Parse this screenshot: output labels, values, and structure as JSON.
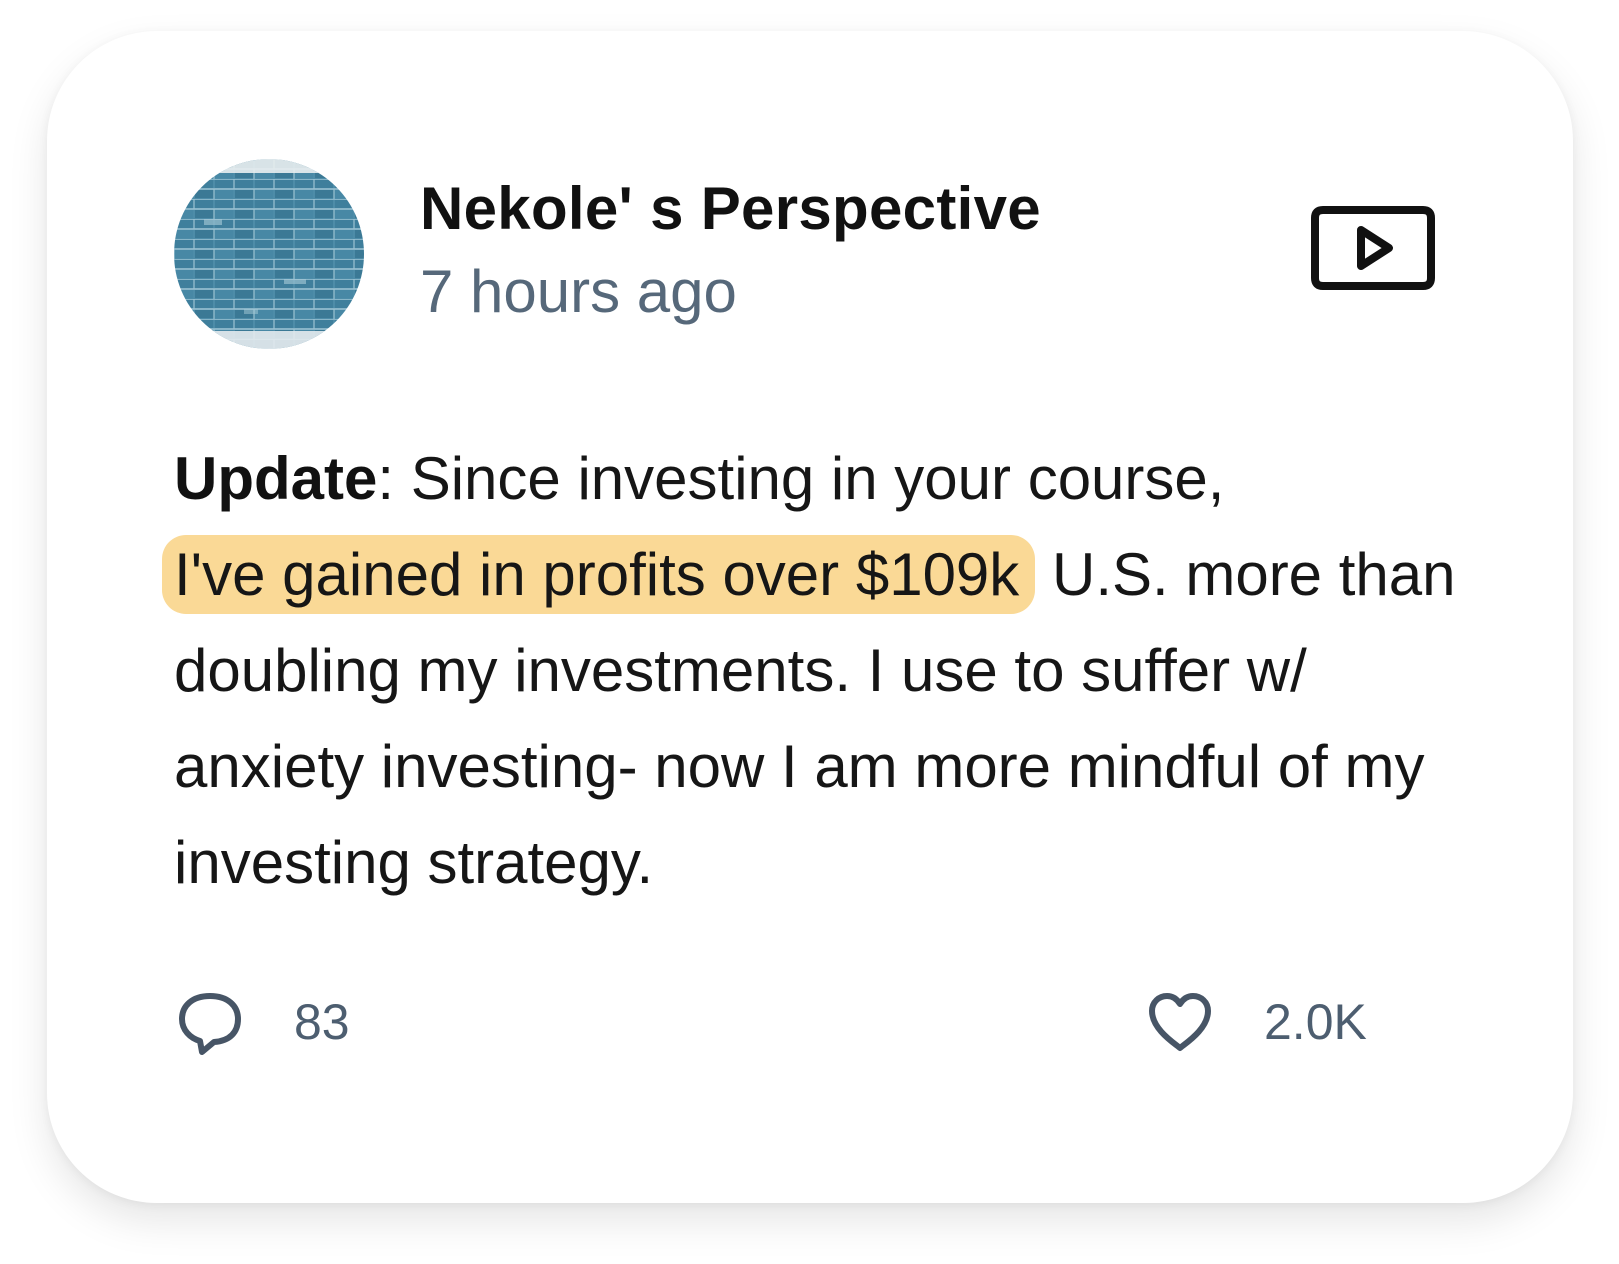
{
  "post": {
    "author": "Nekole' s Perspective",
    "timestamp": "7 hours ago",
    "body_lead": "Update",
    "body_sep": ": Since investing in your course, ",
    "body_highlight": "I've gained in profits over $109k",
    "body_rest": " U.S. more than doubling my investments. I use to suffer w/ anxiety investing- now I am more mindful of my investing strategy.",
    "highlight_color": "#fad996"
  },
  "actions": {
    "comments_icon": "comment-icon",
    "comments_count": "83",
    "likes_icon": "heart-icon",
    "likes_count": "2.0K",
    "video_icon": "video-play-icon"
  },
  "avatar": {
    "description_icon": "brick-wall-avatar",
    "color": "#4a8aa6"
  },
  "colors": {
    "text": "#111111",
    "muted": "#56687a",
    "highlight": "#fad996"
  }
}
